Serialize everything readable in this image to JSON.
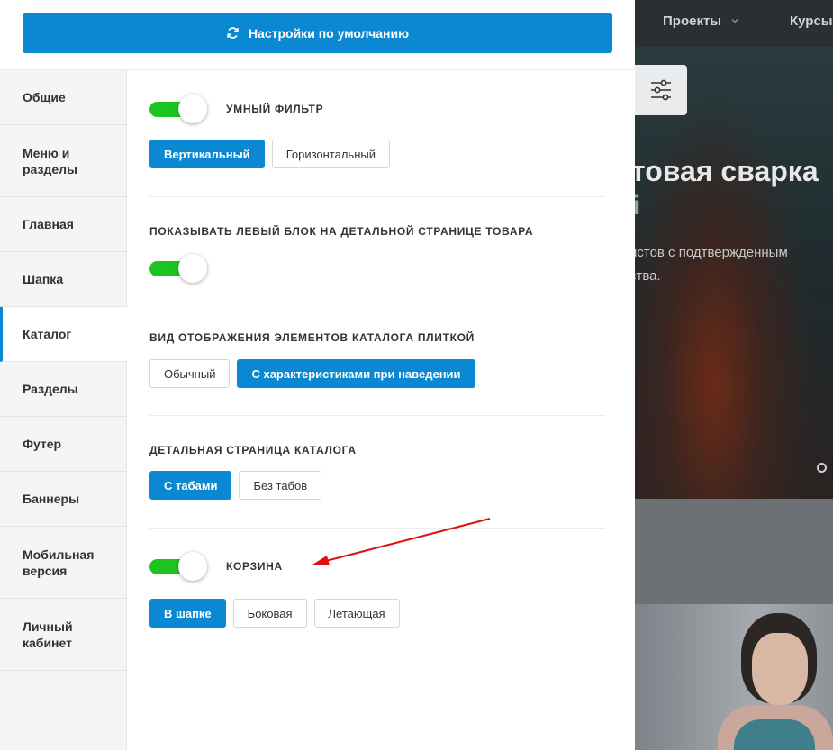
{
  "page": {
    "background_nav": [
      "Проекты",
      "Курсы"
    ],
    "hero_title": "товая сварка",
    "hero_title_2": "і",
    "hero_sub_1": "истов с подтвержденным",
    "hero_sub_2": "ства."
  },
  "top": {
    "reset_label": "Настройки по умолчанию"
  },
  "sidebar": {
    "items": [
      {
        "label": "Общие"
      },
      {
        "label": "Меню и\nразделы"
      },
      {
        "label": "Главная"
      },
      {
        "label": "Шапка"
      },
      {
        "label": "Каталог"
      },
      {
        "label": "Разделы"
      },
      {
        "label": "Футер"
      },
      {
        "label": "Баннеры"
      },
      {
        "label": "Мобильная\nверсия"
      },
      {
        "label": "Личный\nкабинет"
      }
    ]
  },
  "sections": {
    "smart_filter": {
      "label": "УМНЫЙ ФИЛЬТР",
      "enabled": true,
      "options": [
        "Вертикальный",
        "Горизонтальный"
      ],
      "selected": "Вертикальный"
    },
    "left_block": {
      "label": "ПОКАЗЫВАТЬ ЛЕВЫЙ БЛОК НА ДЕТАЛЬНОЙ СТРАНИЦЕ ТОВАРА",
      "enabled": true
    },
    "tile_view": {
      "label": "ВИД ОТОБРАЖЕНИЯ ЭЛЕМЕНТОВ КАТАЛОГА ПЛИТКОЙ",
      "options": [
        "Обычный",
        "С характеристиками при наведении"
      ],
      "selected": "С характеристиками при наведении"
    },
    "detail_page": {
      "label": "ДЕТАЛЬНАЯ СТРАНИЦА КАТАЛОГА",
      "options": [
        "С табами",
        "Без табов"
      ],
      "selected": "С табами"
    },
    "cart": {
      "label": "КОРЗИНА",
      "enabled": true,
      "options": [
        "В шапке",
        "Боковая",
        "Летающая"
      ],
      "selected": "В шапке"
    }
  },
  "colors": {
    "accent": "#0a88d2",
    "toggle_on": "#1ec41e",
    "annotation_arrow": "#e01010"
  },
  "icons": {
    "reset": "refresh-icon",
    "settings": "sliders-icon",
    "nav_dropdown": "chevron-down-icon"
  }
}
